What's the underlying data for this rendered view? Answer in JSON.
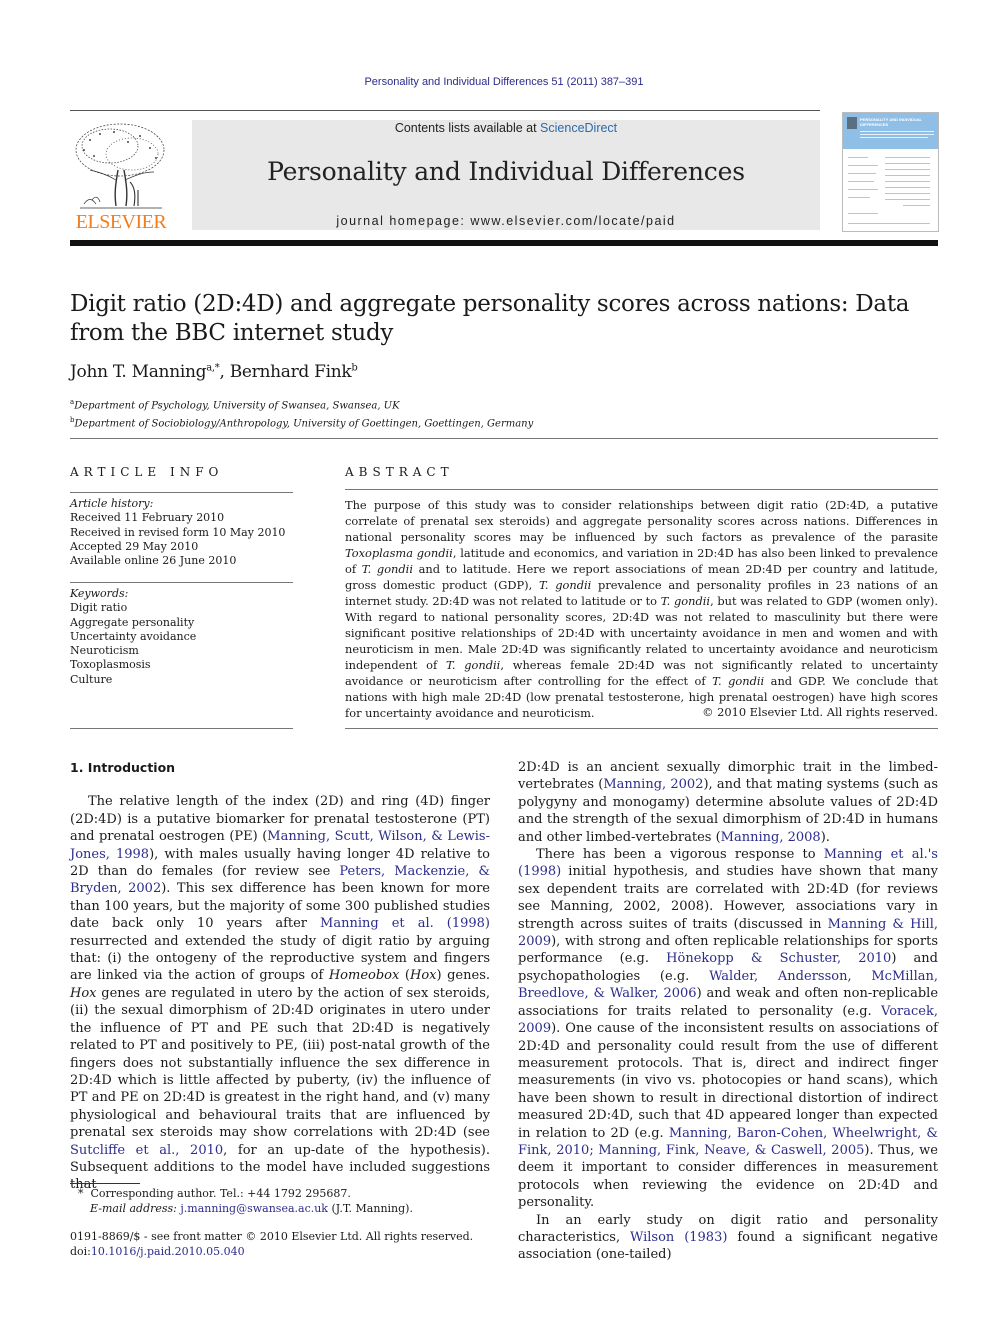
{
  "running_header": "Personality and Individual Differences 51 (2011) 387–391",
  "masthead": {
    "contents_prefix": "Contents lists available at ",
    "contents_link": "ScienceDirect",
    "journal_name": "Personality and Individual Differences",
    "homepage": "journal homepage: www.elsevier.com/locate/paid",
    "publisher_logo_text": "ELSEVIER",
    "cover_title": "PERSONALITY AND INDIVIDUAL DIFFERENCES"
  },
  "colors": {
    "link": "#2c2c8c",
    "elsevier_orange": "#f07e1f",
    "sciencedirect": "#2c6aa8",
    "masthead_bg": "#e8e8e8"
  },
  "title": "Digit ratio (2D:4D) and aggregate personality scores across nations: Data from the BBC internet study",
  "authors": [
    {
      "name": "John T. Manning",
      "sup": "a,*"
    },
    {
      "name": "Bernhard Fink",
      "sup": "b"
    }
  ],
  "affiliations": [
    {
      "mark": "a",
      "text": "Department of Psychology, University of Swansea, Swansea, UK"
    },
    {
      "mark": "b",
      "text": "Department of Sociobiology/Anthropology, University of Goettingen, Goettingen, Germany"
    }
  ],
  "article_info": {
    "heading": "ARTICLE INFO",
    "history_label": "Article history:",
    "history": [
      "Received 11 February 2010",
      "Received in revised form 10 May 2010",
      "Accepted 29 May 2010",
      "Available online 26 June 2010"
    ],
    "keywords_label": "Keywords:",
    "keywords": [
      "Digit ratio",
      "Aggregate personality",
      "Uncertainty avoidance",
      "Neuroticism",
      "Toxoplasmosis",
      "Culture"
    ]
  },
  "abstract": {
    "heading": "ABSTRACT",
    "segments": [
      {
        "t": "The purpose of this study was to consider relationships between digit ratio (2D:4D, a putative correlate of prenatal sex steroids) and aggregate personality scores across nations. Differences in national personality scores may be influenced by such factors as prevalence of the parasite "
      },
      {
        "t": "Toxoplasma gondii",
        "i": true
      },
      {
        "t": ", latitude and economics, and variation in 2D:4D has also been linked to prevalence of "
      },
      {
        "t": "T. gondii",
        "i": true
      },
      {
        "t": " and to latitude. Here we report associations of mean 2D:4D per country and latitude, gross domestic product (GDP), "
      },
      {
        "t": "T. gondii",
        "i": true
      },
      {
        "t": " prevalence and personality profiles in 23 nations of an internet study. 2D:4D was not related to latitude or to "
      },
      {
        "t": "T. gondii",
        "i": true
      },
      {
        "t": ", but was related to GDP (women only). With regard to national personality scores, 2D:4D was not related to masculinity but there were significant positive relationships of 2D:4D with uncertainty avoidance in men and women and with neuroticism in men. Male 2D:4D was significantly related to uncertainty avoidance and neuroticism independent of "
      },
      {
        "t": "T. gondii",
        "i": true
      },
      {
        "t": ", whereas female 2D:4D was not significantly related to uncertainty avoidance or neuroticism after controlling for the effect of "
      },
      {
        "t": "T. gondii",
        "i": true
      },
      {
        "t": " and GDP. We conclude that nations with high male 2D:4D (low prenatal testosterone, high prenatal oestrogen) have high scores for uncertainty avoidance and neuroticism."
      }
    ],
    "copyright": "© 2010 Elsevier Ltd. All rights reserved."
  },
  "section": {
    "heading": "1. Introduction"
  },
  "body_left": [
    [
      {
        "t": "The relative length of the index (2D) and ring (4D) finger (2D:4D) is a putative biomarker for prenatal testosterone (PT) and prenatal oestrogen (PE) ("
      },
      {
        "t": "Manning, Scutt, Wilson, & Lewis-Jones, 1998",
        "link": true
      },
      {
        "t": "), with males usually having longer 4D relative to 2D than do females (for review see "
      },
      {
        "t": "Peters, Mackenzie, & Bryden, 2002",
        "link": true
      },
      {
        "t": "). This sex difference has been known for more than 100 years, but the majority of some 300 published studies date back only 10 years after "
      },
      {
        "t": "Manning et al. (1998)",
        "link": true
      },
      {
        "t": " resurrected and extended the study of digit ratio by arguing that: (i) the ontogeny of the reproductive system and fingers are linked via the action of groups of "
      },
      {
        "t": "Homeobox",
        "i": true
      },
      {
        "t": " ("
      },
      {
        "t": "Hox",
        "i": true
      },
      {
        "t": ") genes. "
      },
      {
        "t": "Hox",
        "i": true
      },
      {
        "t": " genes are regulated in utero by the action of sex steroids, (ii) the sexual dimorphism of 2D:4D originates in utero under the influence of PT and PE such that 2D:4D is negatively related to PT and positively to PE, (iii) post-natal growth of the fingers does not substantially influence the sex difference in 2D:4D which is little affected by puberty, (iv) the influence of PT and PE on 2D:4D is greatest in the right hand, and (v) many physiological and behavioural traits that are influenced by prenatal sex steroids may show correlations with 2D:4D (see "
      },
      {
        "t": "Sutcliffe et al., 2010",
        "link": true
      },
      {
        "t": ", for an up-date of the hypothesis). Subsequent additions to the model have included suggestions that"
      }
    ]
  ],
  "body_right": [
    [
      {
        "t": "2D:4D is an ancient sexually dimorphic trait in the limbed-vertebrates ("
      },
      {
        "t": "Manning, 2002",
        "link": true
      },
      {
        "t": "), and that mating systems (such as polygyny and monogamy) determine absolute values of 2D:4D and the strength of the sexual dimorphism of 2D:4D in humans and other limbed-vertebrates ("
      },
      {
        "t": "Manning, 2008",
        "link": true
      },
      {
        "t": ")."
      }
    ],
    [
      {
        "t": "There has been a vigorous response to "
      },
      {
        "t": "Manning et al.'s (1998)",
        "link": true
      },
      {
        "t": " initial hypothesis, and studies have shown that many sex dependent traits are correlated with 2D:4D (for reviews see Manning, 2002, 2008). However, associations vary in strength across suites of traits (discussed in "
      },
      {
        "t": "Manning & Hill, 2009",
        "link": true
      },
      {
        "t": "), with strong and often replicable relationships for sports performance (e.g. "
      },
      {
        "t": "Hönekopp & Schuster, 2010",
        "link": true
      },
      {
        "t": ") and psychopathologies (e.g. "
      },
      {
        "t": "Walder, Andersson, McMillan, Breedlove, & Walker, 2006",
        "link": true
      },
      {
        "t": ") and weak and often non-replicable associations for traits related to personality (e.g. "
      },
      {
        "t": "Voracek, 2009",
        "link": true
      },
      {
        "t": "). One cause of the inconsistent results on associations of 2D:4D and personality could result from the use of different measurement protocols. That is, direct and indirect finger measurements (in vivo vs. photocopies or hand scans), which have been shown to result in directional distortion of indirect measured 2D:4D, such that 4D appeared longer than expected in relation to 2D (e.g. "
      },
      {
        "t": "Manning, Baron-Cohen, Wheelwright, & Fink, 2010; Manning, Fink, Neave, & Caswell, 2005",
        "link": true
      },
      {
        "t": "). Thus, we deem it important to consider differences in measurement protocols when reviewing the evidence on 2D:4D and personality."
      }
    ],
    [
      {
        "t": "In an early study on digit ratio and personality characteristics, "
      },
      {
        "t": "Wilson (1983)",
        "link": true
      },
      {
        "t": " found a significant negative association (one-tailed)"
      }
    ]
  ],
  "footnote": {
    "mark": "*",
    "text": "Corresponding author. Tel.: +44 1792 295687.",
    "email_label": "E-mail address:",
    "email": "j.manning@swansea.ac.uk",
    "email_suffix": " (J.T. Manning)."
  },
  "issn_line": "0191-8869/$ - see front matter © 2010 Elsevier Ltd. All rights reserved.",
  "doi_label": "doi:",
  "doi": "10.1016/j.paid.2010.05.040"
}
